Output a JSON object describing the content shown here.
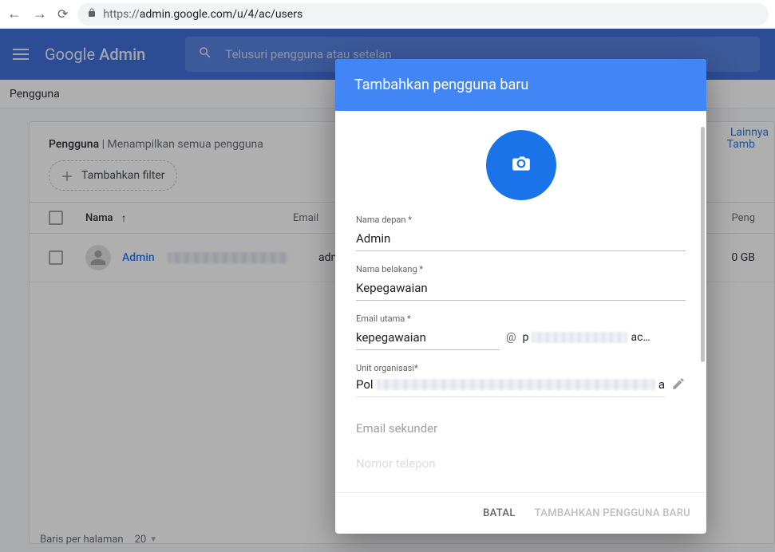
{
  "browser": {
    "url_proto": "https://",
    "url_rest": "admin.google.com/u/4/ac/users"
  },
  "header": {
    "logo_a": "Google",
    "logo_b": " Admin",
    "search_placeholder": "Telusuri pengguna atau setelan"
  },
  "breadcrumb": "Pengguna",
  "listing": {
    "title_strong": "Pengguna",
    "title_rest": " | Menampilkan semua pengguna",
    "add_link": "Tamb",
    "more_link": "Lainnya",
    "add_filter": "Tambahkan filter",
    "col_name": "Nama",
    "col_email": "Email",
    "col_storage": "Peng"
  },
  "rows": [
    {
      "name": "Admin",
      "email": "admin@",
      "storage": "0 GB"
    }
  ],
  "pager": {
    "label": "Baris per halaman",
    "value": "20"
  },
  "dialog": {
    "title": "Tambahkan pengguna baru",
    "first_label": "Nama depan *",
    "first_value": "Admin",
    "last_label": "Nama belakang *",
    "last_value": "Kepegawaian",
    "email_label": "Email utama *",
    "email_value": "kepegawaian",
    "domain_prefix": "p",
    "domain_suffix": "ac…",
    "org_label": "Unit organisasi*",
    "org_prefix": "Pol",
    "org_suffix": "a",
    "secondary_email_placeholder": "Email sekunder",
    "phone_placeholder": "Nomor telepon",
    "cancel": "BATAL",
    "submit": "TAMBAHKAN PENGGUNA BARU"
  }
}
